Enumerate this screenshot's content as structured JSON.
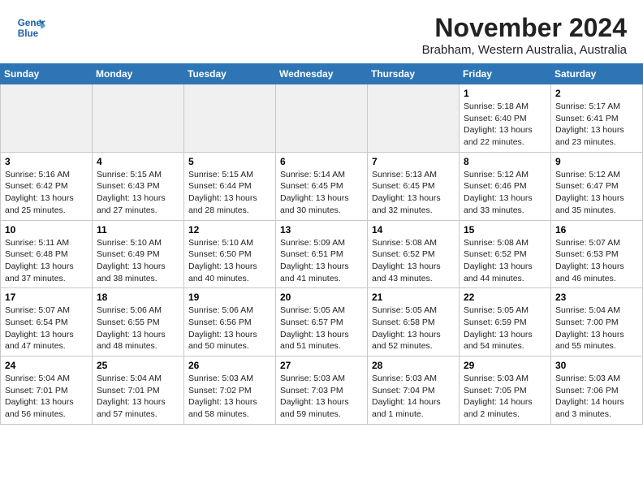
{
  "header": {
    "logo_line1": "General",
    "logo_line2": "Blue",
    "month": "November 2024",
    "location": "Brabham, Western Australia, Australia"
  },
  "days_of_week": [
    "Sunday",
    "Monday",
    "Tuesday",
    "Wednesday",
    "Thursday",
    "Friday",
    "Saturday"
  ],
  "weeks": [
    [
      {
        "day": "",
        "info": ""
      },
      {
        "day": "",
        "info": ""
      },
      {
        "day": "",
        "info": ""
      },
      {
        "day": "",
        "info": ""
      },
      {
        "day": "",
        "info": ""
      },
      {
        "day": "1",
        "info": "Sunrise: 5:18 AM\nSunset: 6:40 PM\nDaylight: 13 hours\nand 22 minutes."
      },
      {
        "day": "2",
        "info": "Sunrise: 5:17 AM\nSunset: 6:41 PM\nDaylight: 13 hours\nand 23 minutes."
      }
    ],
    [
      {
        "day": "3",
        "info": "Sunrise: 5:16 AM\nSunset: 6:42 PM\nDaylight: 13 hours\nand 25 minutes."
      },
      {
        "day": "4",
        "info": "Sunrise: 5:15 AM\nSunset: 6:43 PM\nDaylight: 13 hours\nand 27 minutes."
      },
      {
        "day": "5",
        "info": "Sunrise: 5:15 AM\nSunset: 6:44 PM\nDaylight: 13 hours\nand 28 minutes."
      },
      {
        "day": "6",
        "info": "Sunrise: 5:14 AM\nSunset: 6:45 PM\nDaylight: 13 hours\nand 30 minutes."
      },
      {
        "day": "7",
        "info": "Sunrise: 5:13 AM\nSunset: 6:45 PM\nDaylight: 13 hours\nand 32 minutes."
      },
      {
        "day": "8",
        "info": "Sunrise: 5:12 AM\nSunset: 6:46 PM\nDaylight: 13 hours\nand 33 minutes."
      },
      {
        "day": "9",
        "info": "Sunrise: 5:12 AM\nSunset: 6:47 PM\nDaylight: 13 hours\nand 35 minutes."
      }
    ],
    [
      {
        "day": "10",
        "info": "Sunrise: 5:11 AM\nSunset: 6:48 PM\nDaylight: 13 hours\nand 37 minutes."
      },
      {
        "day": "11",
        "info": "Sunrise: 5:10 AM\nSunset: 6:49 PM\nDaylight: 13 hours\nand 38 minutes."
      },
      {
        "day": "12",
        "info": "Sunrise: 5:10 AM\nSunset: 6:50 PM\nDaylight: 13 hours\nand 40 minutes."
      },
      {
        "day": "13",
        "info": "Sunrise: 5:09 AM\nSunset: 6:51 PM\nDaylight: 13 hours\nand 41 minutes."
      },
      {
        "day": "14",
        "info": "Sunrise: 5:08 AM\nSunset: 6:52 PM\nDaylight: 13 hours\nand 43 minutes."
      },
      {
        "day": "15",
        "info": "Sunrise: 5:08 AM\nSunset: 6:52 PM\nDaylight: 13 hours\nand 44 minutes."
      },
      {
        "day": "16",
        "info": "Sunrise: 5:07 AM\nSunset: 6:53 PM\nDaylight: 13 hours\nand 46 minutes."
      }
    ],
    [
      {
        "day": "17",
        "info": "Sunrise: 5:07 AM\nSunset: 6:54 PM\nDaylight: 13 hours\nand 47 minutes."
      },
      {
        "day": "18",
        "info": "Sunrise: 5:06 AM\nSunset: 6:55 PM\nDaylight: 13 hours\nand 48 minutes."
      },
      {
        "day": "19",
        "info": "Sunrise: 5:06 AM\nSunset: 6:56 PM\nDaylight: 13 hours\nand 50 minutes."
      },
      {
        "day": "20",
        "info": "Sunrise: 5:05 AM\nSunset: 6:57 PM\nDaylight: 13 hours\nand 51 minutes."
      },
      {
        "day": "21",
        "info": "Sunrise: 5:05 AM\nSunset: 6:58 PM\nDaylight: 13 hours\nand 52 minutes."
      },
      {
        "day": "22",
        "info": "Sunrise: 5:05 AM\nSunset: 6:59 PM\nDaylight: 13 hours\nand 54 minutes."
      },
      {
        "day": "23",
        "info": "Sunrise: 5:04 AM\nSunset: 7:00 PM\nDaylight: 13 hours\nand 55 minutes."
      }
    ],
    [
      {
        "day": "24",
        "info": "Sunrise: 5:04 AM\nSunset: 7:01 PM\nDaylight: 13 hours\nand 56 minutes."
      },
      {
        "day": "25",
        "info": "Sunrise: 5:04 AM\nSunset: 7:01 PM\nDaylight: 13 hours\nand 57 minutes."
      },
      {
        "day": "26",
        "info": "Sunrise: 5:03 AM\nSunset: 7:02 PM\nDaylight: 13 hours\nand 58 minutes."
      },
      {
        "day": "27",
        "info": "Sunrise: 5:03 AM\nSunset: 7:03 PM\nDaylight: 13 hours\nand 59 minutes."
      },
      {
        "day": "28",
        "info": "Sunrise: 5:03 AM\nSunset: 7:04 PM\nDaylight: 14 hours\nand 1 minute."
      },
      {
        "day": "29",
        "info": "Sunrise: 5:03 AM\nSunset: 7:05 PM\nDaylight: 14 hours\nand 2 minutes."
      },
      {
        "day": "30",
        "info": "Sunrise: 5:03 AM\nSunset: 7:06 PM\nDaylight: 14 hours\nand 3 minutes."
      }
    ]
  ]
}
